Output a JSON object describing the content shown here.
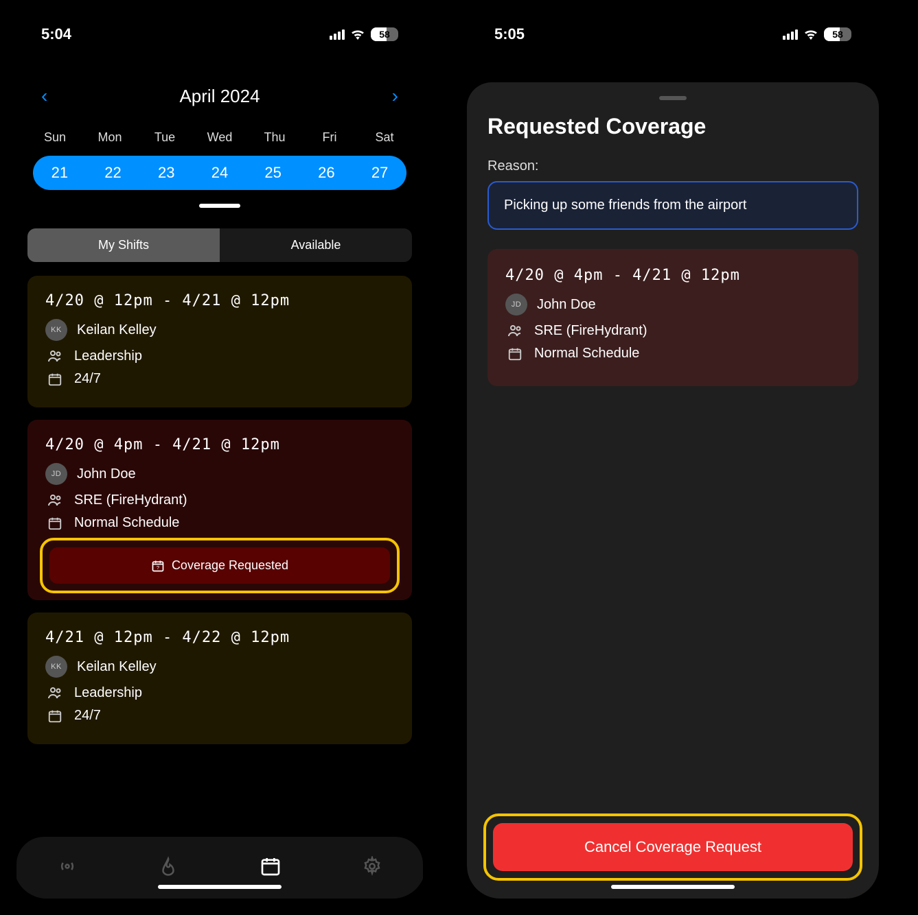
{
  "left": {
    "status": {
      "time": "5:04",
      "battery": "58"
    },
    "calendar": {
      "title": "April 2024",
      "weekdays": [
        "Sun",
        "Mon",
        "Tue",
        "Wed",
        "Thu",
        "Fri",
        "Sat"
      ],
      "days": [
        "21",
        "22",
        "23",
        "24",
        "25",
        "26",
        "27"
      ]
    },
    "tabs": {
      "mine": "My Shifts",
      "available": "Available"
    },
    "shifts": [
      {
        "time": "4/20 @ 12pm - 4/21 @ 12pm",
        "initials": "KK",
        "person": "Keilan Kelley",
        "team": "Leadership",
        "schedule": "24/7",
        "tone": "yellow"
      },
      {
        "time": "4/20 @ 4pm - 4/21 @ 12pm",
        "initials": "JD",
        "person": "John Doe",
        "team": "SRE (FireHydrant)",
        "schedule": "Normal Schedule",
        "tone": "red",
        "coverage_label": "Coverage Requested"
      },
      {
        "time": "4/21 @ 12pm - 4/22 @ 12pm",
        "initials": "KK",
        "person": "Keilan Kelley",
        "team": "Leadership",
        "schedule": "24/7",
        "tone": "yellow"
      }
    ]
  },
  "right": {
    "status": {
      "time": "5:05",
      "battery": "58"
    },
    "sheet": {
      "title": "Requested Coverage",
      "reason_label": "Reason:",
      "reason_text": "Picking up some friends from the airport",
      "detail": {
        "time": "4/20 @ 4pm - 4/21 @ 12pm",
        "initials": "JD",
        "person": "John Doe",
        "team": "SRE (FireHydrant)",
        "schedule": "Normal Schedule"
      },
      "cancel_label": "Cancel Coverage Request"
    }
  }
}
